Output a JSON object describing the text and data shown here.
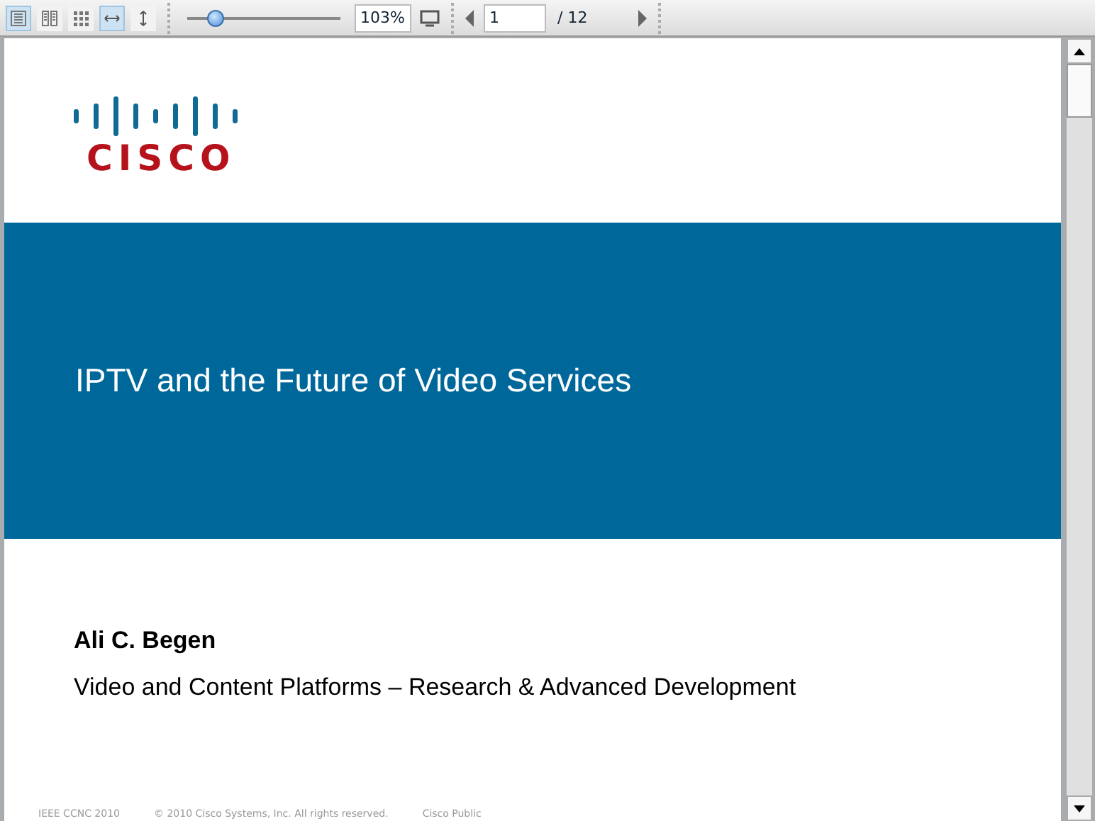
{
  "toolbar": {
    "view_buttons": [
      {
        "kind": "single",
        "selected": true
      },
      {
        "kind": "double",
        "selected": false
      },
      {
        "kind": "grid",
        "selected": false
      },
      {
        "kind": "fit-width",
        "selected": true
      },
      {
        "kind": "fit-height",
        "selected": false
      }
    ],
    "zoom_slider": {
      "level": 0.13
    },
    "zoom_value": "103%",
    "page_value": "1",
    "page_total": "/ 12"
  },
  "slide": {
    "logo_text": "CISCO",
    "title": "IPTV and the Future of Video Services",
    "author": "Ali C. Begen",
    "affiliation": "Video and Content Platforms – Research & Advanced Development",
    "footer": [
      "IEEE CCNC 2010",
      "© 2010 Cisco Systems, Inc. All rights reserved.",
      "Cisco Public"
    ]
  }
}
